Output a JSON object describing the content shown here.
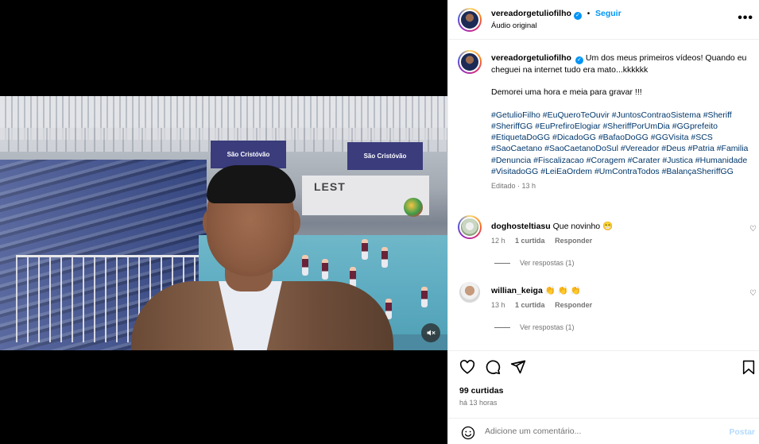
{
  "post": {
    "username": "vereadorgetuliofilho",
    "follow_label": "Seguir",
    "audio_label": "Áudio original",
    "more_label": "•••",
    "caption_text": "Um dos meus primeiros vídeos! Quando eu cheguei na internet tudo era mato...kkkkkk",
    "caption_line2": "Demorei uma hora e meia para gravar !!!",
    "hashtags": "#GetulioFilho #EuQueroTeOuvir #JuntosContraoSistema #Sheriff #SheriffGG #EuPrefiroElogiar #SheriffPorUmDia #GGprefeito #EtiquetaDoGG #DicadoGG #BafaoDoGG #GGVisita #SCS #SaoCaetano #SaoCaetanoDoSul #Vereador #Deus #Patria #Familia #Denuncia #Fiscalizacao #Coragem #Carater #Justica #Humanidade #VisitadoGG #LeiEaOrdem #UmContraTodos #BalançaSheriffGG",
    "edited_label": "Editado · 13 h"
  },
  "video": {
    "banner1": "São Cristóvão",
    "banner2": "São Cristóvão",
    "wall_text": "LEST",
    "mute_icon": "muted-speaker-icon"
  },
  "comments": [
    {
      "username": "doghosteltiasu",
      "text": "Que novinho 😁",
      "time": "12 h",
      "likes": "1 curtida",
      "reply": "Responder",
      "view_replies": "Ver respostas (1)"
    },
    {
      "username": "willian_keiga",
      "text": "👏 👏 👏",
      "time": "13 h",
      "likes": "1 curtida",
      "reply": "Responder",
      "view_replies": "Ver respostas (1)"
    }
  ],
  "actions": {
    "likes_count": "99 curtidas",
    "posted_time": "há 13 horas",
    "comment_placeholder": "Adicione um comentário...",
    "post_label": "Postar"
  },
  "colors": {
    "accent": "#0095f6",
    "hashtag": "#00376b",
    "muted_text": "#737373"
  }
}
